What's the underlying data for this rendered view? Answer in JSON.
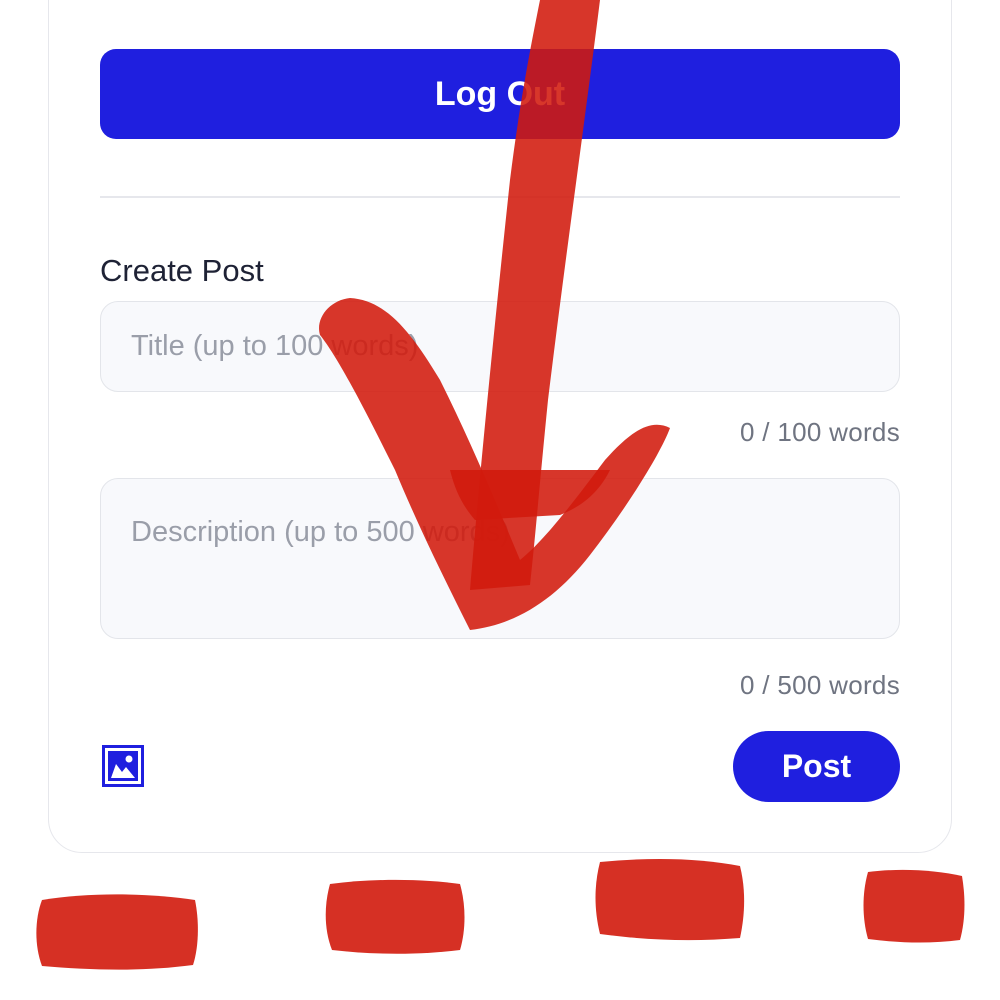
{
  "header": {
    "logout_label": "Log Out"
  },
  "create_post": {
    "section_title": "Create Post",
    "title_field": {
      "placeholder": "Title (up to 100 words)",
      "value": "",
      "counter": "0 / 100 words"
    },
    "description_field": {
      "placeholder": "Description (up to 500 words)",
      "value": "",
      "counter": "0 / 500 words"
    },
    "attach_image_icon": "image-icon",
    "post_label": "Post"
  },
  "colors": {
    "accent": "#1f1fdf",
    "field_bg": "#f8f9fc",
    "border": "#e6e7ec",
    "placeholder": "#9a9ea9",
    "counter_text": "#6f7481",
    "annotation_red": "#d11a0c"
  },
  "annotations": {
    "arrow": "red-arrow-pointing-down",
    "redaction_marks": 4
  }
}
